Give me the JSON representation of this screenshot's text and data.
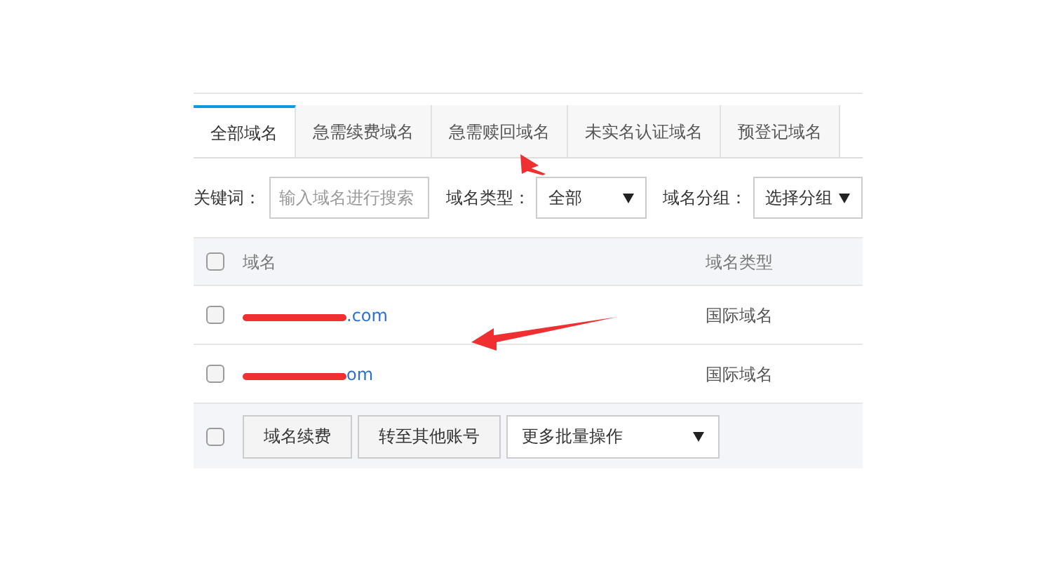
{
  "tabs": [
    {
      "label": "全部域名",
      "selected": true
    },
    {
      "label": "急需续费域名",
      "selected": false
    },
    {
      "label": "急需赎回域名",
      "selected": false
    },
    {
      "label": "未实名认证域名",
      "selected": false
    },
    {
      "label": "预登记域名",
      "selected": false
    }
  ],
  "filters": {
    "keyword_label": "关键词：",
    "keyword_placeholder": "输入域名进行搜索",
    "type_label": "域名类型：",
    "type_value": "全部",
    "group_label": "域名分组：",
    "group_value": "选择分组"
  },
  "table": {
    "columns": [
      "域名",
      "域名类型"
    ],
    "header_checked": false,
    "rows": [
      {
        "domain": ".com",
        "type": "国际域名",
        "checked": false,
        "redacted": true
      },
      {
        "domain": "om",
        "type": "国际域名",
        "checked": false,
        "redacted": true
      }
    ]
  },
  "footer": {
    "checked": false,
    "buttons": [
      "域名续费",
      "转至其他账号"
    ],
    "batch_select": "更多批量操作"
  }
}
